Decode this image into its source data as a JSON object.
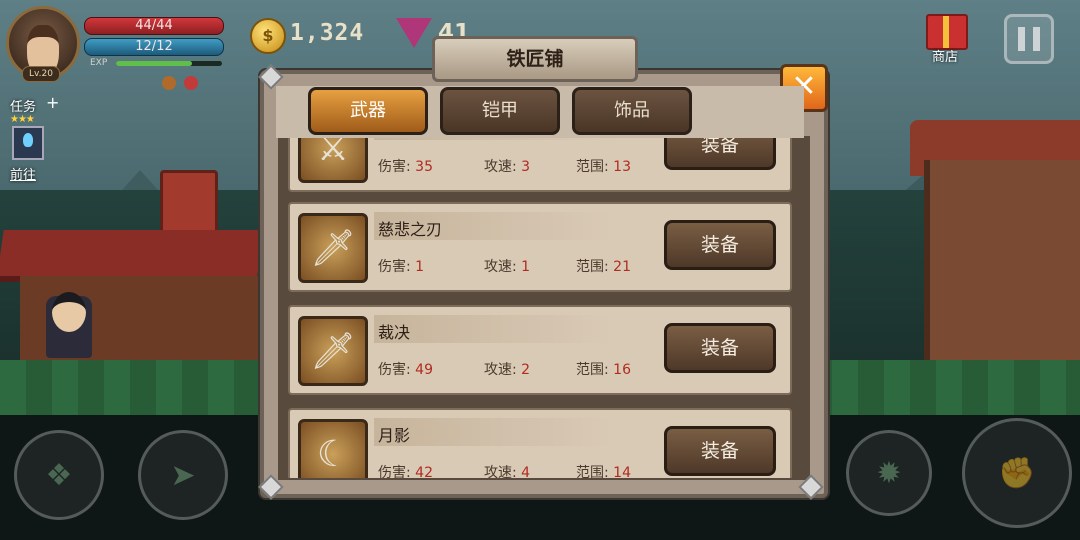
{
  "hud": {
    "level": "Lv.20",
    "hp": "44/44",
    "mp": "12/12",
    "exp_label": "EXP",
    "exp_fraction": 0.72,
    "gold": "1,324",
    "gems": "41",
    "shop_label": "商店"
  },
  "quest": {
    "task_label": "任务",
    "plus": "+",
    "stars": "★★★",
    "goto_label": "前往"
  },
  "dialog": {
    "title": "铁匠铺",
    "close": "✕",
    "tabs": [
      {
        "label": "武器",
        "active": true
      },
      {
        "label": "铠甲",
        "active": false
      },
      {
        "label": "饰品",
        "active": false
      }
    ],
    "stat_labels": {
      "damage": "伤害:",
      "speed": "攻速:",
      "range": "范围:"
    },
    "equip_label": "装备",
    "weapons": [
      {
        "name": "",
        "damage": "35",
        "speed": "3",
        "range": "13",
        "icon": "sword-red-icon"
      },
      {
        "name": "慈悲之刃",
        "damage": "1",
        "speed": "1",
        "range": "21",
        "icon": "sword-green-icon"
      },
      {
        "name": "裁决",
        "damage": "49",
        "speed": "2",
        "range": "16",
        "icon": "blade-steel-icon"
      },
      {
        "name": "月影",
        "damage": "42",
        "speed": "4",
        "range": "14",
        "icon": "curved-blade-icon"
      }
    ]
  },
  "controls": {
    "skill1": "❖",
    "skill2": "➤",
    "skill3": "✹",
    "attack": "✊"
  }
}
